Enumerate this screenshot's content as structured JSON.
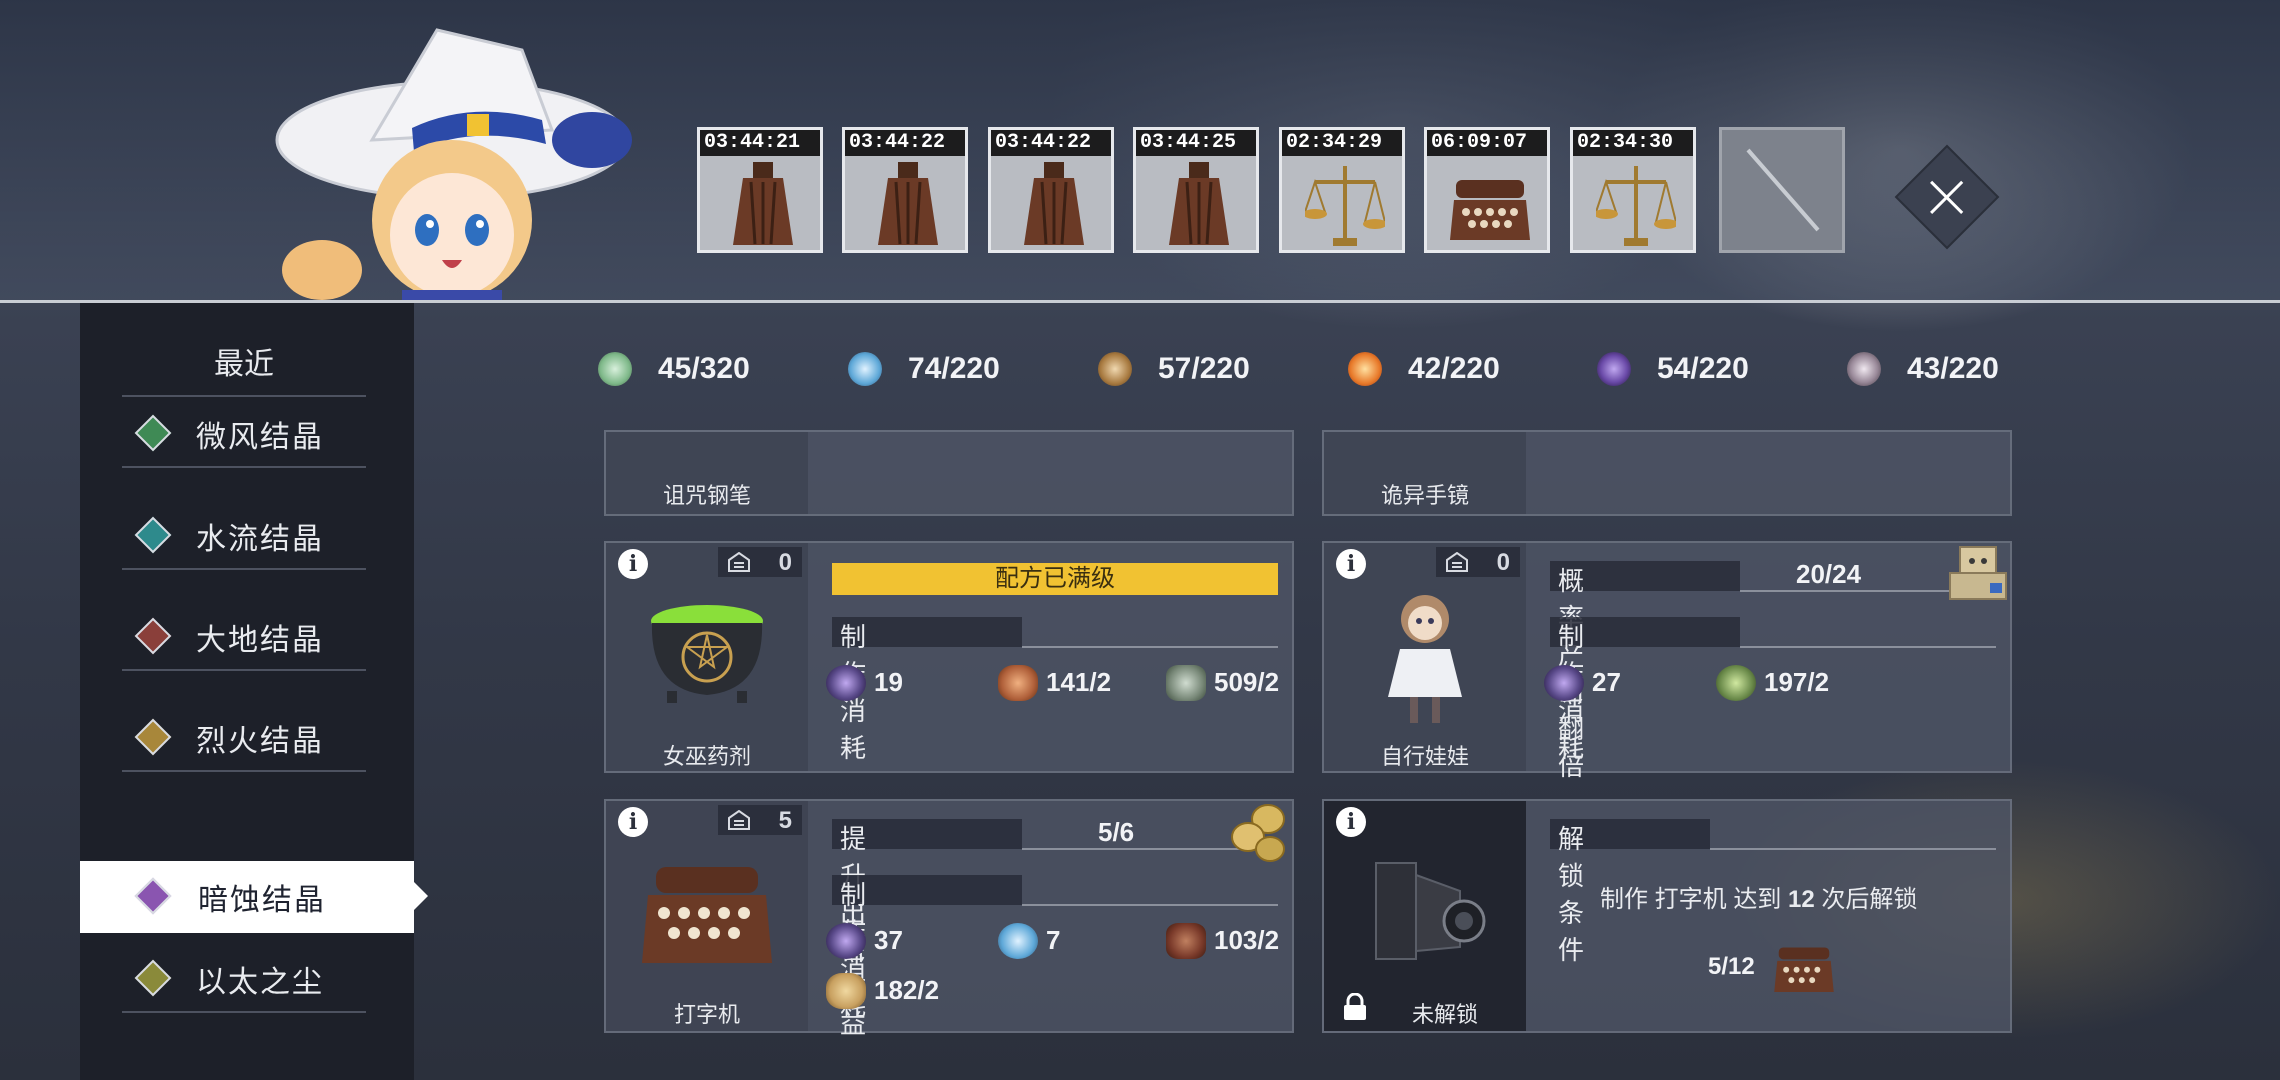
{
  "timers": [
    {
      "time": "03:44:21",
      "icon": "tassel-icon"
    },
    {
      "time": "03:44:22",
      "icon": "tassel-icon"
    },
    {
      "time": "03:44:22",
      "icon": "tassel-icon"
    },
    {
      "time": "03:44:25",
      "icon": "tassel-icon"
    },
    {
      "time": "02:34:29",
      "icon": "scales-icon"
    },
    {
      "time": "06:09:07",
      "icon": "typewriter-icon"
    },
    {
      "time": "02:34:30",
      "icon": "scales-icon"
    }
  ],
  "sidebar": {
    "header": "最近",
    "items": [
      {
        "label": "微风结晶",
        "color": "#3f8a55"
      },
      {
        "label": "水流结晶",
        "color": "#2e8a8c"
      },
      {
        "label": "大地结晶",
        "color": "#8a3f3a"
      },
      {
        "label": "烈火结晶",
        "color": "#a8873a"
      },
      {
        "label": "暗蚀结晶",
        "color": "#8a55b0"
      },
      {
        "label": "以太之尘",
        "color": "#8a8a3a"
      }
    ],
    "active_index": 4
  },
  "currencies": [
    {
      "value": "45/320",
      "color": "#7fb98a"
    },
    {
      "value": "74/220",
      "color": "#5ea8d8"
    },
    {
      "value": "57/220",
      "color": "#a87a40"
    },
    {
      "value": "42/220",
      "color": "#e87a2a"
    },
    {
      "value": "54/220",
      "color": "#6a4aa8"
    },
    {
      "value": "43/220",
      "color": "#9a8a9a"
    }
  ],
  "top_partial": {
    "left_name": "诅咒钢笔",
    "right_name": "诡异手镜"
  },
  "cards": {
    "potion": {
      "name": "女巫药剂",
      "stock": "0",
      "banner": "配方已满级",
      "cost_title": "制作消耗",
      "materials": [
        {
          "qty": "19",
          "color": "#5a4a8a"
        },
        {
          "qty": "141/2",
          "color": "#b0603a"
        },
        {
          "qty": "509/2",
          "color": "#7a8a7a"
        }
      ]
    },
    "doll": {
      "name": "自行娃娃",
      "stock": "0",
      "bonus_label": "概率产出翻倍",
      "bonus_value": "20/24",
      "cost_title": "制作消耗",
      "materials": [
        {
          "qty": "27",
          "color": "#5a4a8a"
        },
        {
          "qty": "197/2",
          "color": "#6a8a4a"
        }
      ]
    },
    "typewriter": {
      "name": "打字机",
      "stock": "5",
      "bonus_label": "提升出售收益",
      "bonus_value": "5/6",
      "cost_title": "制作消耗",
      "materials": [
        {
          "qty": "37",
          "color": "#5a4a8a"
        },
        {
          "qty": "7",
          "color": "#5ea8d8"
        },
        {
          "qty": "103/2",
          "color": "#7a3a2a"
        },
        {
          "qty": "182/2",
          "color": "#c8a060"
        }
      ]
    },
    "camera": {
      "name": "未解锁",
      "unlock_title": "解锁条件",
      "unlock_prefix": "制作 打字机 达到 ",
      "unlock_count": "12",
      "unlock_suffix": " 次后解锁",
      "progress": "5/12"
    }
  }
}
